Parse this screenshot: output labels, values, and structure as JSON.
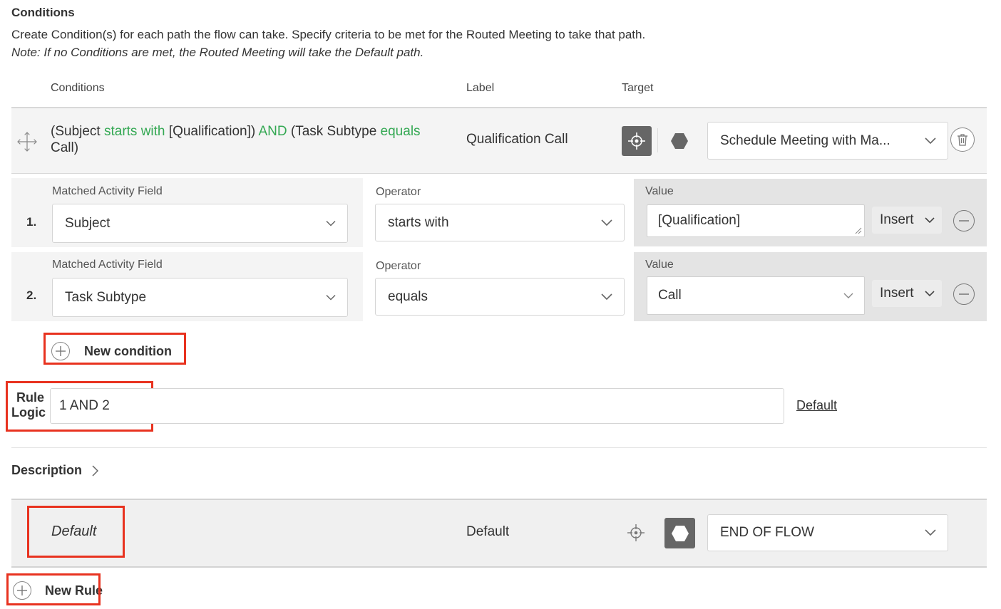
{
  "header": {
    "title": "Conditions",
    "description": "Create Condition(s) for each path the flow can take. Specify criteria to be met for the Routed Meeting to take that path.",
    "note": "Note: If no Conditions are met, the Routed Meeting will take the Default path."
  },
  "columns": {
    "conditions": "Conditions",
    "label": "Label",
    "target": "Target"
  },
  "rule": {
    "summary": {
      "p1": "(Subject ",
      "k1": "starts with",
      "p2": " [Qualification]) ",
      "k2": "AND",
      "p3": " (Task Subtype ",
      "k3": "equals",
      "p4": " Call)"
    },
    "label": "Qualification Call",
    "target_value": "Schedule Meeting with Ma...",
    "conditions": [
      {
        "number": "1.",
        "field_label": "Matched Activity Field",
        "field_value": "Subject",
        "operator_label": "Operator",
        "operator_value": "starts with",
        "value_label": "Value",
        "value": "[Qualification]",
        "insert_label": "Insert"
      },
      {
        "number": "2.",
        "field_label": "Matched Activity Field",
        "field_value": "Task Subtype",
        "operator_label": "Operator",
        "operator_value": "equals",
        "value_label": "Value",
        "value": "Call",
        "insert_label": "Insert"
      }
    ],
    "new_condition_label": "New condition",
    "rule_logic_label_line1": "Rule",
    "rule_logic_label_line2": "Logic",
    "rule_logic_value": "1 AND 2",
    "default_link": "Default",
    "description_label": "Description"
  },
  "default_rule": {
    "name": "Default",
    "label": "Default",
    "target_value": "END OF FLOW"
  },
  "new_rule_label": "New Rule",
  "colors": {
    "keyword": "#34a853",
    "highlight": "#e8321f",
    "dark_button": "#666666"
  }
}
